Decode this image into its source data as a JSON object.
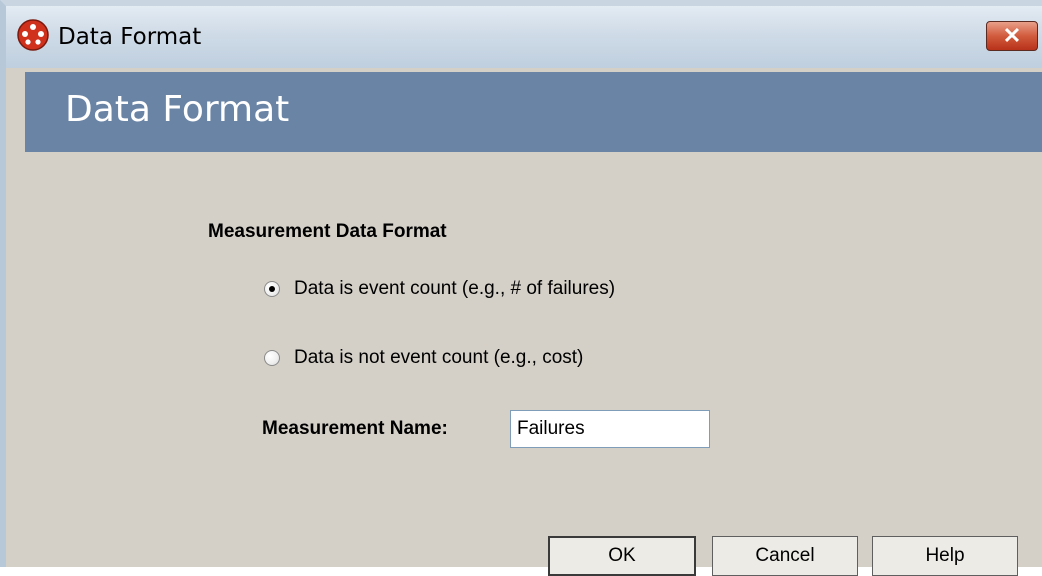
{
  "window": {
    "title": "Data Format",
    "close_label": "✕"
  },
  "banner": {
    "title": "Data Format"
  },
  "form": {
    "section_label": "Measurement Data Format",
    "radio_options": [
      {
        "label": "Data is event count (e.g., # of failures)",
        "checked": true
      },
      {
        "label": "Data is not event count (e.g., cost)",
        "checked": false
      }
    ],
    "measurement_name_label": "Measurement Name:",
    "measurement_name_value": "Failures"
  },
  "buttons": {
    "ok": "OK",
    "cancel": "Cancel",
    "help": "Help"
  }
}
